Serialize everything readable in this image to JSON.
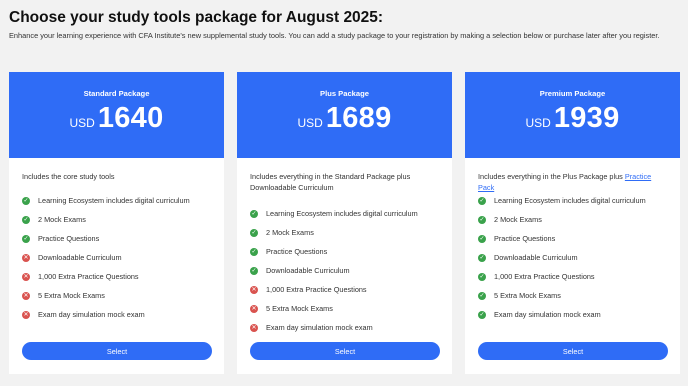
{
  "page": {
    "title": "Choose your study tools package for August 2025:",
    "subtitle": "Enhance your learning experience with CFA Institute's new supplemental study tools. You can add a study package to your registration by making a selection below or purchase later after you register."
  },
  "colors": {
    "accent": "#2f6cf6",
    "included": "#3aa24b",
    "excluded": "#d9534f",
    "background": "#f2f2f2"
  },
  "packages": [
    {
      "name": "Standard Package",
      "currency": "USD",
      "price": "1640",
      "description": "Includes the core study tools",
      "description_link": "",
      "select_label": "Select",
      "features": [
        {
          "label": "Learning Ecosystem includes digital curriculum",
          "included": true,
          "icon": "check-circle-icon"
        },
        {
          "label": "2 Mock Exams",
          "included": true,
          "icon": "check-circle-icon"
        },
        {
          "label": "Practice Questions",
          "included": true,
          "icon": "check-circle-icon"
        },
        {
          "label": "Downloadable Curriculum",
          "included": false,
          "icon": "x-circle-icon"
        },
        {
          "label": "1,000 Extra Practice Questions",
          "included": false,
          "icon": "x-circle-icon"
        },
        {
          "label": "5 Extra Mock Exams",
          "included": false,
          "icon": "x-circle-icon"
        },
        {
          "label": "Exam day simulation mock exam",
          "included": false,
          "icon": "x-circle-icon"
        }
      ]
    },
    {
      "name": "Plus Package",
      "currency": "USD",
      "price": "1689",
      "description": "Includes everything in the Standard Package plus Downloadable Curriculum",
      "description_link": "",
      "select_label": "Select",
      "features": [
        {
          "label": "Learning Ecosystem includes digital curriculum",
          "included": true,
          "icon": "check-circle-icon"
        },
        {
          "label": "2 Mock Exams",
          "included": true,
          "icon": "check-circle-icon"
        },
        {
          "label": "Practice Questions",
          "included": true,
          "icon": "check-circle-icon"
        },
        {
          "label": "Downloadable Curriculum",
          "included": true,
          "icon": "check-circle-icon"
        },
        {
          "label": "1,000 Extra Practice Questions",
          "included": false,
          "icon": "x-circle-icon"
        },
        {
          "label": "5 Extra Mock Exams",
          "included": false,
          "icon": "x-circle-icon"
        },
        {
          "label": "Exam day simulation mock exam",
          "included": false,
          "icon": "x-circle-icon"
        }
      ]
    },
    {
      "name": "Premium Package",
      "currency": "USD",
      "price": "1939",
      "description": "Includes everything in the Plus Package plus",
      "description_link": "Practice Pack",
      "select_label": "Select",
      "features": [
        {
          "label": "Learning Ecosystem includes digital curriculum",
          "included": true,
          "icon": "check-circle-icon"
        },
        {
          "label": "2 Mock Exams",
          "included": true,
          "icon": "check-circle-icon"
        },
        {
          "label": "Practice Questions",
          "included": true,
          "icon": "check-circle-icon"
        },
        {
          "label": "Downloadable Curriculum",
          "included": true,
          "icon": "check-circle-icon"
        },
        {
          "label": "1,000 Extra Practice Questions",
          "included": true,
          "icon": "check-circle-icon"
        },
        {
          "label": "5 Extra Mock Exams",
          "included": true,
          "icon": "check-circle-icon"
        },
        {
          "label": "Exam day simulation mock exam",
          "included": true,
          "icon": "check-circle-icon"
        }
      ]
    }
  ]
}
